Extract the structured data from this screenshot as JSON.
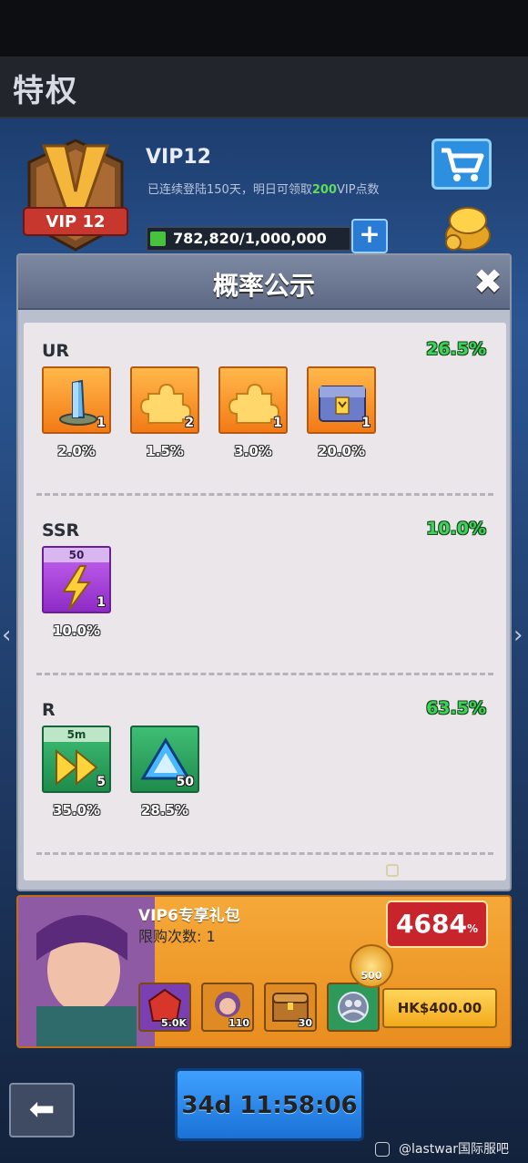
{
  "page": {
    "title": "特权"
  },
  "vip": {
    "badge_label": "VIP 12",
    "name": "VIP12",
    "desc_prefix": "已连续登陆150天，明日可领取",
    "desc_highlight": "200",
    "desc_suffix": "VIP点数",
    "progress_text": "782,820/1,000,000",
    "progress_ratio": 0.7828,
    "plus_label": "+",
    "cart_icon": "cart-icon"
  },
  "modal": {
    "title": "概率公示",
    "close_label": "✖",
    "sections": [
      {
        "name": "UR",
        "percent": "26.5%",
        "items": [
          {
            "icon": "crystal-tower-icon",
            "count": "1",
            "prob": "2.0%"
          },
          {
            "icon": "puzzle-piece-icon",
            "count": "2",
            "prob": "1.5%"
          },
          {
            "icon": "puzzle-piece-icon",
            "count": "1",
            "prob": "3.0%"
          },
          {
            "icon": "supply-chest-icon",
            "count": "1",
            "prob": "20.0%"
          }
        ]
      },
      {
        "name": "SSR",
        "percent": "10.0%",
        "items": [
          {
            "icon": "lightning-icon",
            "top_label": "50",
            "count": "1",
            "prob": "10.0%"
          }
        ]
      },
      {
        "name": "R",
        "percent": "63.5%",
        "items": [
          {
            "icon": "speedup-icon",
            "top_label": "5m",
            "count": "5",
            "prob": "35.0%"
          },
          {
            "icon": "blue-triangle-icon",
            "count": "50",
            "prob": "28.5%"
          }
        ]
      }
    ]
  },
  "pack": {
    "title": "VIP6专享礼包",
    "limit": "限购次数: 1",
    "discount_value": "4684",
    "discount_unit": "%",
    "rewards": [
      {
        "icon": "red-gem-icon",
        "label": "5.0K"
      },
      {
        "icon": "hero-portrait-icon",
        "label": "110"
      },
      {
        "icon": "treasure-chest-icon",
        "label": "30"
      },
      {
        "icon": "group-icon",
        "label": ""
      }
    ],
    "coin_label": "500",
    "price": "HK$400.00"
  },
  "timer": "34d 11:58:06",
  "watermark": "@lastwar国际服吧",
  "colors": {
    "accent_green": "#3fd15a",
    "ur_tile": "#f37a16",
    "ssr_tile": "#8e2bc6",
    "r_tile": "#1f8c4c"
  }
}
